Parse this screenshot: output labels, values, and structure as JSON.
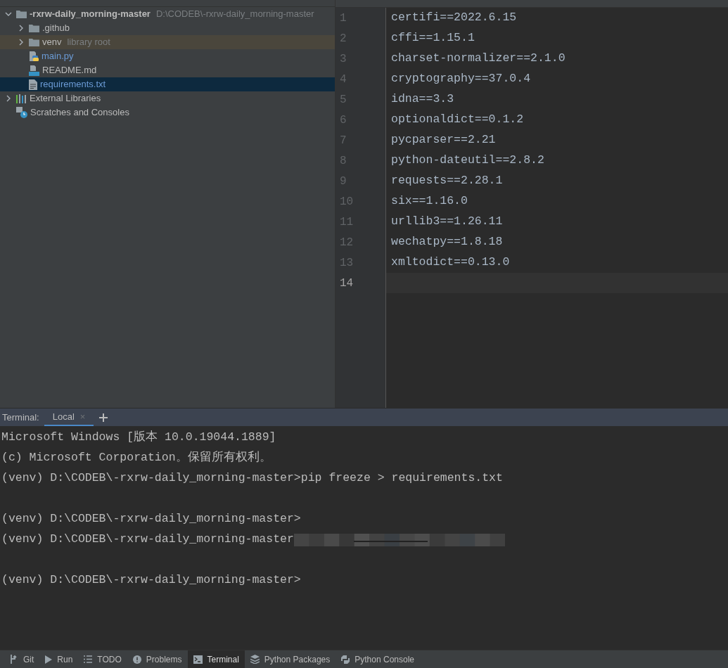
{
  "project_tree": [
    {
      "name": "-rxrw-daily_morning-master",
      "hint": "D:\\CODEB\\-rxrw-daily_morning-master",
      "kind": "folder",
      "expanded": true,
      "selected": false,
      "bold": true,
      "children": [
        {
          "name": ".github",
          "kind": "folder",
          "expanded": false,
          "selected": false
        },
        {
          "name": "venv",
          "hint": "library root",
          "kind": "folder",
          "expanded": false,
          "selected": false,
          "highlighted": true
        },
        {
          "name": "main.py",
          "kind": "python",
          "selected": false
        },
        {
          "name": "README.md",
          "kind": "markdown",
          "selected": false
        },
        {
          "name": "requirements.txt",
          "kind": "text",
          "selected": true
        }
      ]
    },
    {
      "name": "External Libraries",
      "kind": "libraries",
      "expanded": false,
      "selected": false
    },
    {
      "name": "Scratches and Consoles",
      "kind": "scratches",
      "selected": false
    }
  ],
  "editor": {
    "lines": [
      {
        "number": "1",
        "text": "certifi==2022.6.15"
      },
      {
        "number": "2",
        "text": "cffi==1.15.1"
      },
      {
        "number": "3",
        "text": "charset-normalizer==2.1.0"
      },
      {
        "number": "4",
        "text": "cryptography==37.0.4"
      },
      {
        "number": "5",
        "text": "idna==3.3"
      },
      {
        "number": "6",
        "text": "optionaldict==0.1.2"
      },
      {
        "number": "7",
        "text": "pycparser==2.21"
      },
      {
        "number": "8",
        "text": "python-dateutil==2.8.2"
      },
      {
        "number": "9",
        "text": "requests==2.28.1"
      },
      {
        "number": "10",
        "text": "six==1.16.0"
      },
      {
        "number": "11",
        "text": "urllib3==1.26.11"
      },
      {
        "number": "12",
        "text": "wechatpy==1.8.18"
      },
      {
        "number": "13",
        "text": "xmltodict==0.13.0"
      },
      {
        "number": "14",
        "current": true
      }
    ]
  },
  "terminal": {
    "title": "Terminal:",
    "tabs": [
      {
        "label": "Local",
        "close": "×",
        "selected": true
      }
    ],
    "lines": [
      {
        "text": "Microsoft Windows [版本 10.0.19044.1889]"
      },
      {
        "text": "(c) Microsoft Corporation。保留所有权利。"
      },
      {
        "text": "(venv) D:\\CODEB\\-rxrw-daily_morning-master>pip freeze > requirements.txt",
        "blank_line_after": true
      },
      {
        "text": "(venv) D:\\CODEB\\-rxrw-daily_morning-master>"
      },
      {
        "text": "(venv) D:\\CODEB\\-rxrw-daily_morning-master",
        "redacted": true,
        "blank_line_after": true
      },
      {
        "text": "(venv) D:\\CODEB\\-rxrw-daily_morning-master>"
      }
    ]
  },
  "tool_windows": [
    {
      "label": "Git",
      "kind": "git",
      "selected": false
    },
    {
      "label": "Run",
      "kind": "run",
      "selected": false
    },
    {
      "label": "TODO",
      "kind": "todo",
      "selected": false
    },
    {
      "label": "Problems",
      "kind": "problems",
      "selected": false
    },
    {
      "label": "Terminal",
      "kind": "terminal",
      "selected": true
    },
    {
      "label": "Python Packages",
      "kind": "packages",
      "selected": false
    },
    {
      "label": "Python Console",
      "kind": "console",
      "selected": false
    }
  ]
}
